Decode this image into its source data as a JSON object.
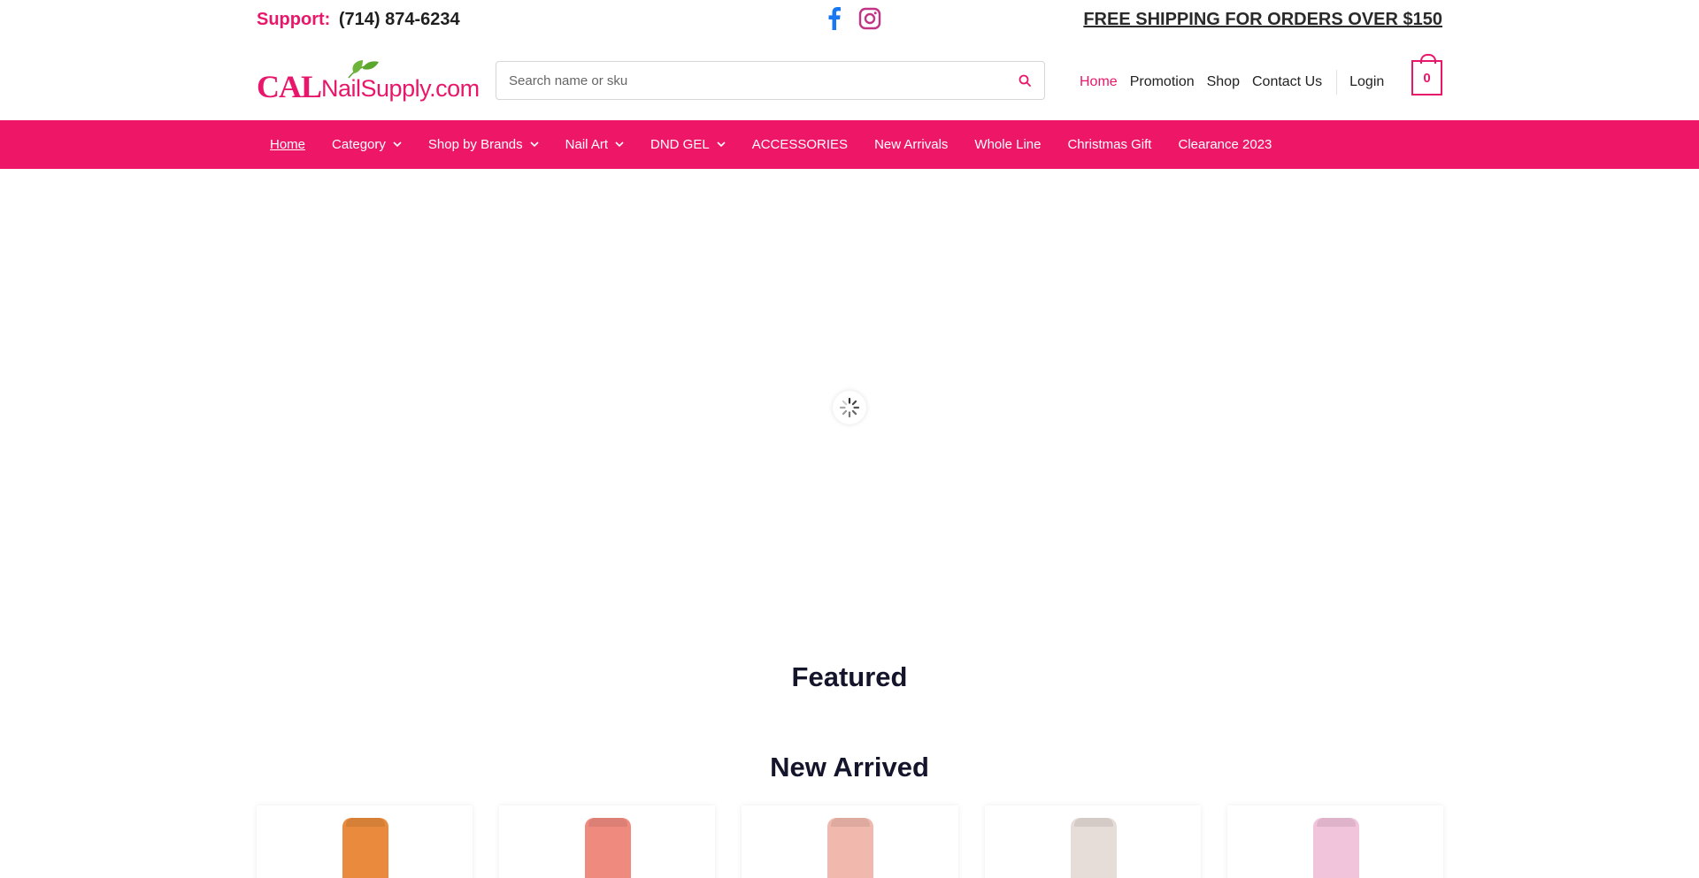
{
  "topbar": {
    "support_label": "Support:",
    "support_phone": "(714) 874-6234",
    "social": [
      "facebook-icon",
      "instagram-icon"
    ],
    "shipping_text": "FREE SHIPPING FOR ORDERS OVER $150"
  },
  "header": {
    "logo_cal": "CAL",
    "logo_rest": "NailSupply.com",
    "search": {
      "placeholder": "Search name or sku",
      "icon": "search-icon"
    },
    "nav": [
      {
        "label": "Home",
        "active": true
      },
      {
        "label": "Promotion",
        "active": false
      },
      {
        "label": "Shop",
        "active": false
      },
      {
        "label": "Contact Us",
        "active": false
      }
    ],
    "login_label": "Login",
    "cart_count": "0"
  },
  "categories": [
    {
      "label": "Home",
      "dropdown": false
    },
    {
      "label": "Category",
      "dropdown": true
    },
    {
      "label": "Shop by Brands",
      "dropdown": true
    },
    {
      "label": "Nail Art",
      "dropdown": true
    },
    {
      "label": "DND GEL",
      "dropdown": true
    },
    {
      "label": "ACCESSORIES",
      "dropdown": false
    },
    {
      "label": "New Arrivals",
      "dropdown": false
    },
    {
      "label": "Whole Line",
      "dropdown": false
    },
    {
      "label": "Christmas Gift",
      "dropdown": false
    },
    {
      "label": "Clearance 2023",
      "dropdown": false
    }
  ],
  "sections": {
    "featured_title": "Featured",
    "new_arrived_title": "New Arrived"
  },
  "products": [
    {
      "bottle_color": "#e98a3c"
    },
    {
      "bottle_color": "#ef8a7e"
    },
    {
      "bottle_color": "#f1b9ae"
    },
    {
      "bottle_color": "#e7ddd8"
    },
    {
      "bottle_color": "#f2c4dc"
    }
  ],
  "colors": {
    "brand": "#ee1667",
    "text_dark": "#14142b"
  }
}
